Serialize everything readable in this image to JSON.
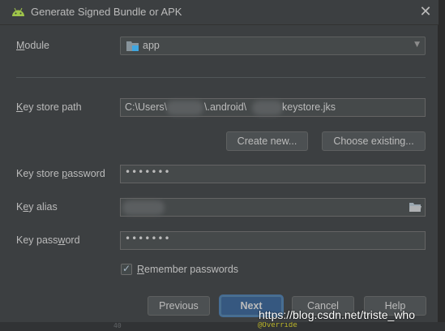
{
  "dialog": {
    "title": "Generate Signed Bundle or APK",
    "close_glyph": "✕",
    "app_icon": "android-icon"
  },
  "module": {
    "label_prefix": "",
    "label_mnemonic": "M",
    "label_rest": "odule",
    "value": "app",
    "icon": "module-folder-icon"
  },
  "key_store_path": {
    "label_mnemonic": "K",
    "label_rest": "ey store path",
    "value_prefix": "C:\\Users\\",
    "value_middle": "\\.android\\",
    "value_suffix": "keystore.jks"
  },
  "buttons": {
    "create_new": "Create new...",
    "choose_existing": "Choose existing...",
    "previous": "Previous",
    "next": "Next",
    "cancel": "Cancel",
    "help": "Help"
  },
  "key_store_password": {
    "label_prefix": "Key store ",
    "label_mnemonic": "p",
    "label_rest": "assword",
    "masked_value": "•••••••"
  },
  "key_alias": {
    "label_prefix": "K",
    "label_mnemonic": "e",
    "label_rest": "y alias",
    "value": ""
  },
  "key_password": {
    "label_prefix": "Key pass",
    "label_mnemonic": "w",
    "label_rest": "ord",
    "masked_value": "•••••••"
  },
  "remember_passwords": {
    "label_mnemonic": "R",
    "label_rest": "emember passwords",
    "checked": true
  },
  "background": {
    "override_text": "@Override",
    "gutter_number": "40"
  },
  "watermark": "https://blog.csdn.net/triste_who",
  "colors": {
    "dialog_bg": "#3c3f41",
    "field_bg": "#45494a",
    "default_button": "#365880",
    "text": "#bbbbbb"
  }
}
